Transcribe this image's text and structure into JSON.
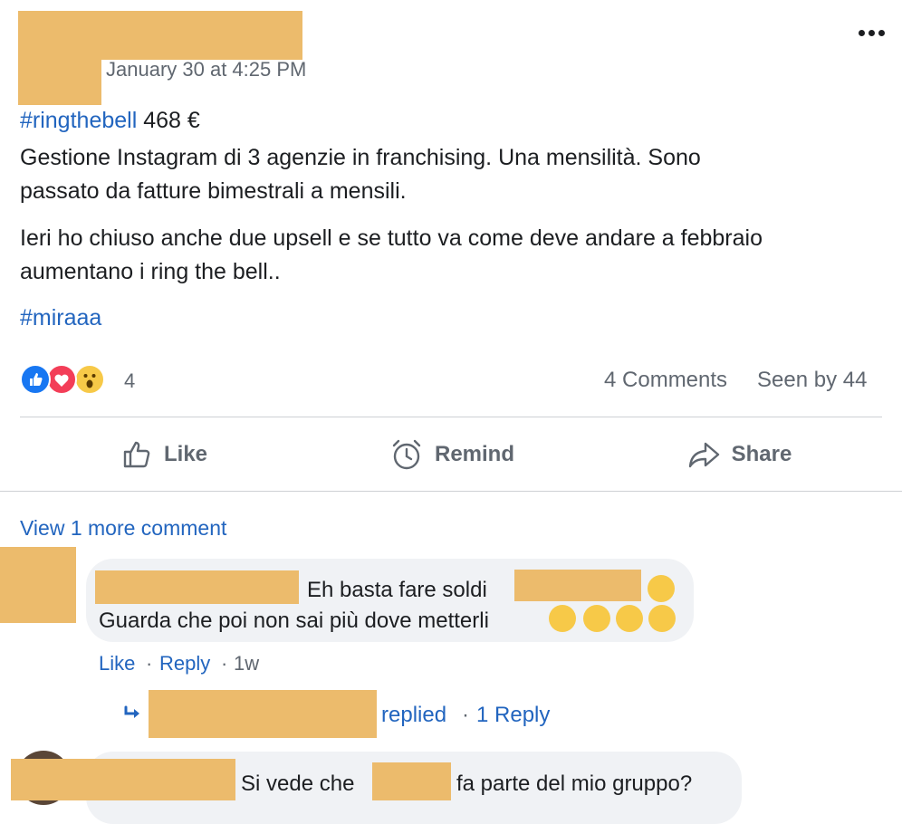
{
  "post": {
    "timestamp": "January 30 at 4:25 PM",
    "hashtag1": "#ringthebell",
    "amount": "468 €",
    "line1": "Gestione Instagram di 3 agenzie in franchising. Una mensilità. Sono",
    "line2": "passato da fatture bimestrali a mensili.",
    "line3": "Ieri ho chiuso anche due upsell e se tutto va come deve andare a febbraio",
    "line4": "aumentano i ring the bell..",
    "hashtag2": "#miraaa"
  },
  "stats": {
    "reaction_count": "4",
    "comments": "4 Comments",
    "seen_by": "Seen by 44",
    "reactions": [
      "like-icon",
      "love-icon",
      "wow-icon"
    ]
  },
  "actions": {
    "like": "Like",
    "remind": "Remind",
    "share": "Share"
  },
  "comments": {
    "view_more": "View 1 more comment",
    "c1": {
      "line1": "Eh basta fare soldi",
      "line2": "Guarda che poi non sai più dove metterli",
      "like": "Like",
      "sep1": "·",
      "reply": "Reply",
      "sep2": "·",
      "time": "1w",
      "replied": "replied",
      "sep3": "·",
      "reply_count": "1 Reply"
    },
    "c2": {
      "text1": "Si vede che",
      "text2": "fa parte del mio gruppo?"
    }
  },
  "colors": {
    "link_blue": "#2265bf",
    "redaction": "#ecbb6c",
    "bubble_bg": "#f0f2f5"
  }
}
